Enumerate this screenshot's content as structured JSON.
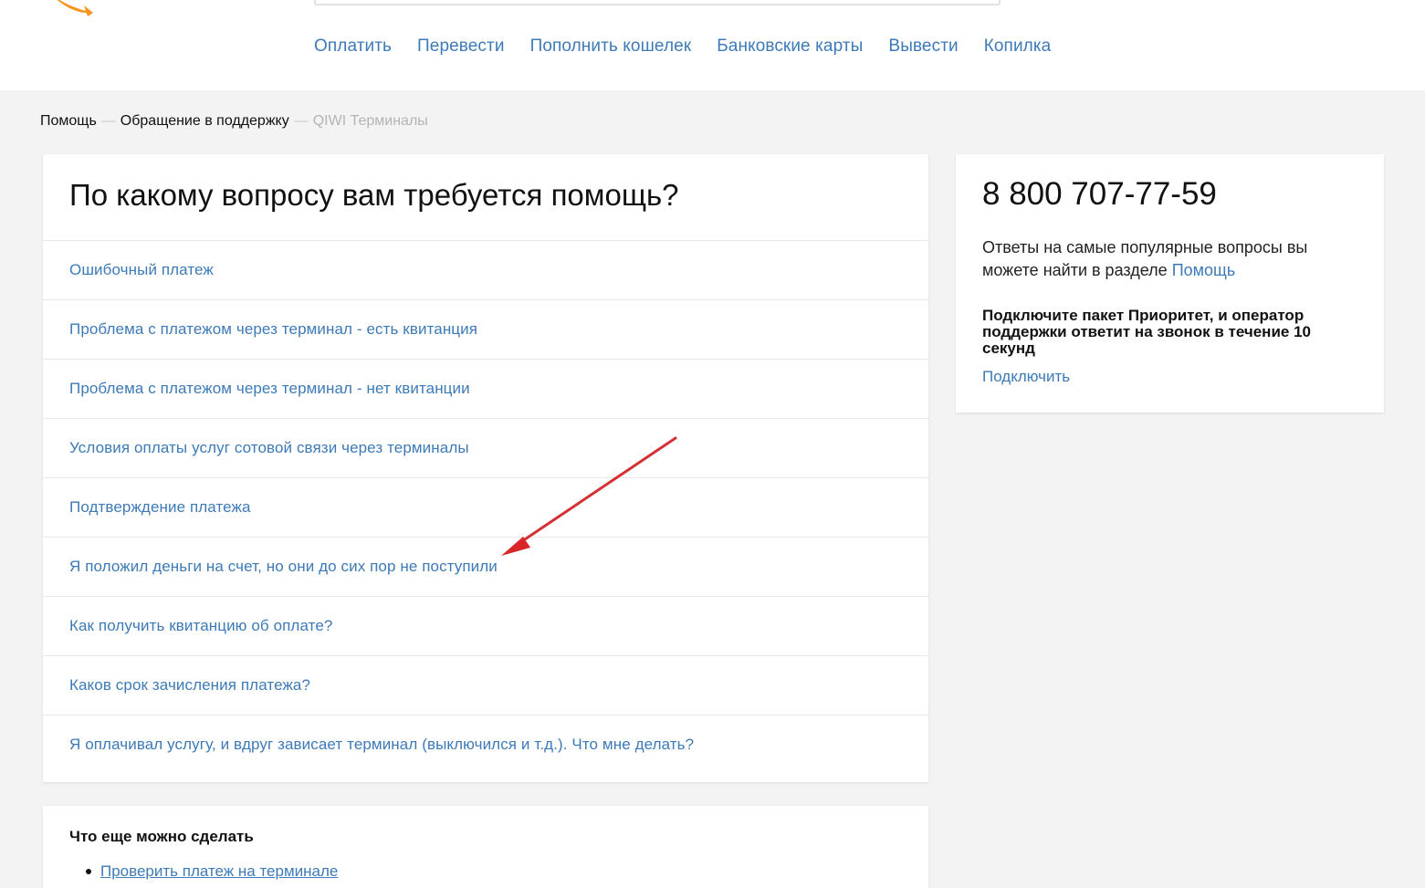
{
  "header": {
    "nav": [
      "Оплатить",
      "Перевести",
      "Пополнить кошелек",
      "Банковские карты",
      "Вывести",
      "Копилка"
    ]
  },
  "breadcrumb": {
    "items": [
      "Помощь",
      "Обращение в поддержку"
    ],
    "separator": "—",
    "current": "QIWI Терминалы"
  },
  "main": {
    "title": "По какому вопросу вам требуется помощь?",
    "questions": [
      "Ошибочный платеж",
      "Проблема с платежом через терминал - есть квитанция",
      "Проблема с платежом через терминал - нет квитанции",
      "Условия оплаты услуг сотовой связи через терминалы",
      "Подтверждение платежа",
      "Я положил деньги на счет, но они до сих пор не поступили",
      "Как получить квитанцию об оплате?",
      "Каков срок зачисления платежа?",
      "Я оплачивал услугу, и вдруг зависает терминал (выключился и т.д.). Что мне делать?"
    ]
  },
  "sidebar": {
    "phone": "8 800 707-77-59",
    "faq_text": "Ответы на самые популярные вопросы вы можете найти в разделе",
    "faq_link": "Помощь",
    "priority_text": "Подключите пакет Приоритет, и оператор поддержки ответит на звонок в течение 10 секунд",
    "connect_link": "Подключить"
  },
  "more": {
    "title": "Что еще можно сделать",
    "items": [
      "Проверить платеж на терминале"
    ]
  },
  "colors": {
    "link": "#3d7ab7",
    "logo": "#f7941d",
    "annotation_arrow": "#d9262b",
    "background": "#f4f3f3"
  }
}
